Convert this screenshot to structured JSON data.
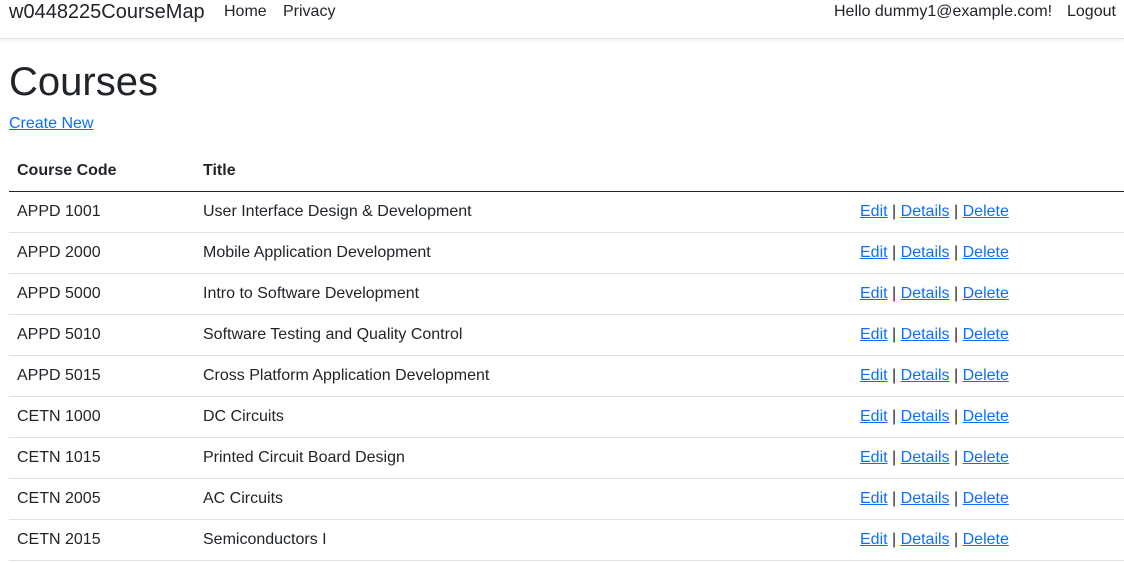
{
  "app": {
    "brand": "w0448225CourseMap",
    "nav": {
      "home": "Home",
      "privacy": "Privacy",
      "hello": "Hello dummy1@example.com!",
      "logout": "Logout"
    }
  },
  "page": {
    "title": "Courses",
    "create_new": "Create New"
  },
  "table": {
    "headers": {
      "code": "Course Code",
      "title": "Title",
      "actions": ""
    },
    "actions": {
      "edit": "Edit",
      "details": "Details",
      "delete": "Delete",
      "separator": "|"
    },
    "rows": [
      {
        "code": "APPD 1001",
        "title": "User Interface Design & Development"
      },
      {
        "code": "APPD 2000",
        "title": "Mobile Application Development"
      },
      {
        "code": "APPD 5000",
        "title": "Intro to Software Development"
      },
      {
        "code": "APPD 5010",
        "title": "Software Testing and Quality Control"
      },
      {
        "code": "APPD 5015",
        "title": "Cross Platform Application Development"
      },
      {
        "code": "CETN 1000",
        "title": "DC Circuits"
      },
      {
        "code": "CETN 1015",
        "title": "Printed Circuit Board Design"
      },
      {
        "code": "CETN 2005",
        "title": "AC Circuits"
      },
      {
        "code": "CETN 2015",
        "title": "Semiconductors I"
      }
    ]
  },
  "colors": {
    "link": "#0d6efd",
    "text": "#212529",
    "border": "#dee2e6"
  }
}
